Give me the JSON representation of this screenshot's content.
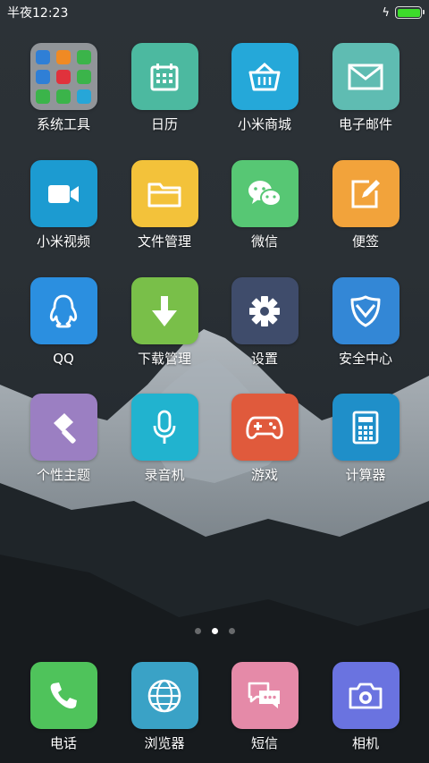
{
  "status": {
    "time": "半夜12:23",
    "battery_level": 1.0
  },
  "apps": [
    {
      "id": "folder-system-tools",
      "label": "系统工具",
      "type": "folder"
    },
    {
      "id": "calendar",
      "label": "日历",
      "icon": "calendar-icon",
      "color": "#4cb9a0"
    },
    {
      "id": "mi-store",
      "label": "小米商城",
      "icon": "basket-icon",
      "color": "#25a8d9"
    },
    {
      "id": "email",
      "label": "电子邮件",
      "icon": "envelope-icon",
      "color": "#5fbcb2"
    },
    {
      "id": "mi-video",
      "label": "小米视频",
      "icon": "video-camera-icon",
      "color": "#1c9bd1"
    },
    {
      "id": "file-manager",
      "label": "文件管理",
      "icon": "folder-icon",
      "color": "#f3c23a"
    },
    {
      "id": "wechat",
      "label": "微信",
      "icon": "chat-bubbles-icon",
      "color": "#57c774"
    },
    {
      "id": "notes",
      "label": "便签",
      "icon": "notepad-pencil-icon",
      "color": "#f2a33b"
    },
    {
      "id": "qq",
      "label": "QQ",
      "icon": "penguin-icon",
      "color": "#2b8fe0"
    },
    {
      "id": "downloads",
      "label": "下载管理",
      "icon": "download-arrow-icon",
      "color": "#79bf49"
    },
    {
      "id": "settings",
      "label": "设置",
      "icon": "gear-icon",
      "color": "#3f4c6b"
    },
    {
      "id": "security-center",
      "label": "安全中心",
      "icon": "shield-icon",
      "color": "#3387d6"
    },
    {
      "id": "themes",
      "label": "个性主题",
      "icon": "brush-icon",
      "color": "#9b7fc2"
    },
    {
      "id": "recorder",
      "label": "录音机",
      "icon": "microphone-icon",
      "color": "#21b3cf"
    },
    {
      "id": "games",
      "label": "游戏",
      "icon": "gamepad-icon",
      "color": "#e05a3c"
    },
    {
      "id": "calculator",
      "label": "计算器",
      "icon": "calculator-icon",
      "color": "#1f8fc9"
    }
  ],
  "dock": [
    {
      "id": "phone",
      "label": "电话",
      "icon": "phone-handset-icon",
      "color": "#4fc35b"
    },
    {
      "id": "browser",
      "label": "浏览器",
      "icon": "globe-icon",
      "color": "#3aa2c6"
    },
    {
      "id": "messages",
      "label": "短信",
      "icon": "message-bubbles-icon",
      "color": "#e58aa8"
    },
    {
      "id": "camera",
      "label": "相机",
      "icon": "camera-icon",
      "color": "#6a73e0"
    }
  ],
  "folder_minis": [
    "#2f7fd6",
    "#f08a24",
    "#3bb44a",
    "#2f7fd6",
    "#e0323c",
    "#3bb44a",
    "#3bb44a",
    "#3bb44a",
    "#27a6d8"
  ],
  "pages": {
    "count": 3,
    "current": 2
  }
}
